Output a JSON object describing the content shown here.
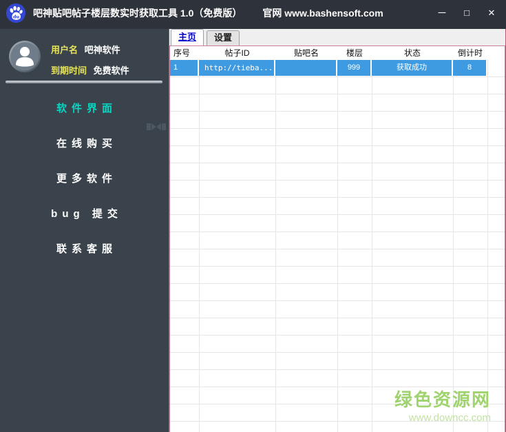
{
  "titlebar": {
    "title": "吧神贴吧帖子楼层数实时获取工具 1.0（免费版）",
    "site": "官网 www.bashensoft.com",
    "logo_text": "du",
    "controls": {
      "minimize": "─",
      "maximize": "□",
      "close": "✕"
    }
  },
  "sidebar": {
    "user": {
      "name_label": "用户名",
      "name_value": "吧神软件",
      "expire_label": "到期时间",
      "expire_value": "免费软件"
    },
    "menu": [
      {
        "label": "软件界面",
        "active": true
      },
      {
        "label": "在线购买",
        "active": false
      },
      {
        "label": "更多软件",
        "active": false
      },
      {
        "label": "bug 提交",
        "active": false
      },
      {
        "label": "联系客服",
        "active": false
      }
    ]
  },
  "main": {
    "tabs": [
      {
        "label": "主页",
        "active": true
      },
      {
        "label": "设置",
        "active": false
      }
    ],
    "table": {
      "columns": [
        "序号",
        "帖子ID",
        "贴吧名",
        "楼层",
        "状态",
        "倒计时"
      ],
      "rows": [
        {
          "index": "1",
          "post_id": "http://tieba....",
          "bar_name": "",
          "floor": "999",
          "status": "获取成功",
          "countdown": "8"
        }
      ]
    }
  },
  "watermark": {
    "line1": "绿色资源网",
    "line2": "www.downcc.com"
  },
  "icons": {
    "logo": "baidu-paw-icon",
    "avatar": "user-silhouette-icon",
    "active_indicator": "active-item-indicator-icon"
  },
  "colors": {
    "titlebar_bg": "#2e323a",
    "sidebar_bg": "#3a434c",
    "menu_active_cyan": "#06d6c2",
    "label_yellow": "#e7e35b",
    "selected_row_blue": "#3f9be1",
    "panel_border_pink": "#b25577",
    "tab_active_text": "#0000cc",
    "watermark_green": "#9fd36d",
    "logo_blue": "#3347d1"
  }
}
